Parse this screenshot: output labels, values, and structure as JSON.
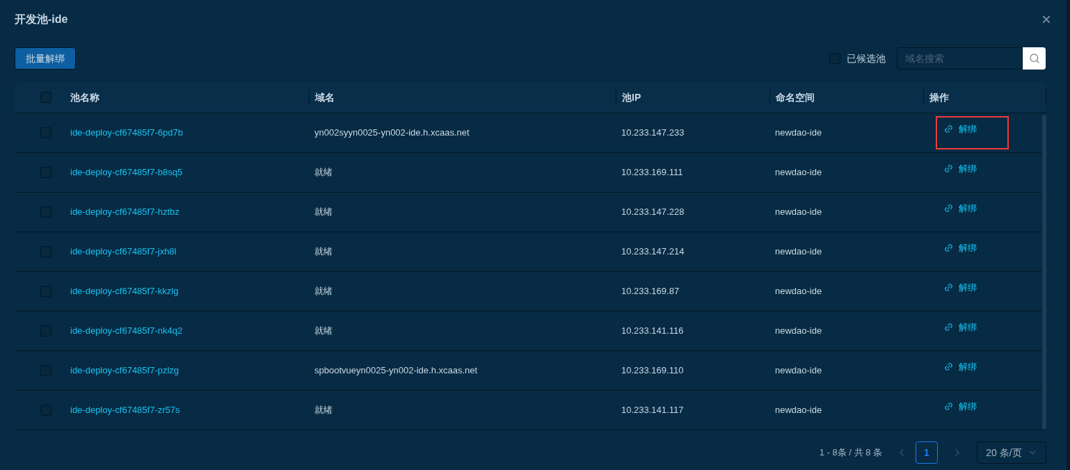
{
  "dialog": {
    "title": "开发池-ide",
    "close": "×"
  },
  "toolbar": {
    "batch_button": "批量解绑",
    "candidate_checkbox": {
      "label": "已候选池",
      "checked": false
    },
    "search": {
      "placeholder": "域名搜索"
    }
  },
  "table": {
    "header_checkbox": {
      "checked": false
    },
    "columns": [
      "池名称",
      "域名",
      "池IP",
      "命名空间",
      "操作"
    ],
    "rows": [
      {
        "checked": false,
        "name": "ide-deploy-cf67485f7-6pd7b",
        "domain": "yn002syyn0025-yn002-ide.h.xcaas.net",
        "ip": "10.233.147.233",
        "namespace": "newdao-ide",
        "action": "解绑",
        "highlighted": true
      },
      {
        "checked": false,
        "name": "ide-deploy-cf67485f7-b8sq5",
        "domain": "就绪",
        "ip": "10.233.169.111",
        "namespace": "newdao-ide",
        "action": "解绑",
        "highlighted": false
      },
      {
        "checked": false,
        "name": "ide-deploy-cf67485f7-hztbz",
        "domain": "就绪",
        "ip": "10.233.147.228",
        "namespace": "newdao-ide",
        "action": "解绑",
        "highlighted": false
      },
      {
        "checked": false,
        "name": "ide-deploy-cf67485f7-jxh8l",
        "domain": "就绪",
        "ip": "10.233.147.214",
        "namespace": "newdao-ide",
        "action": "解绑",
        "highlighted": false
      },
      {
        "checked": false,
        "name": "ide-deploy-cf67485f7-kkzlg",
        "domain": "就绪",
        "ip": "10.233.169.87",
        "namespace": "newdao-ide",
        "action": "解绑",
        "highlighted": false
      },
      {
        "checked": false,
        "name": "ide-deploy-cf67485f7-nk4q2",
        "domain": "就绪",
        "ip": "10.233.141.116",
        "namespace": "newdao-ide",
        "action": "解绑",
        "highlighted": false
      },
      {
        "checked": false,
        "name": "ide-deploy-cf67485f7-pzlzg",
        "domain": "spbootvueyn0025-yn002-ide.h.xcaas.net",
        "ip": "10.233.169.110",
        "namespace": "newdao-ide",
        "action": "解绑",
        "highlighted": false
      },
      {
        "checked": false,
        "name": "ide-deploy-cf67485f7-zr57s",
        "domain": "就绪",
        "ip": "10.233.141.117",
        "namespace": "newdao-ide",
        "action": "解绑",
        "highlighted": false
      }
    ]
  },
  "pagination": {
    "summary": "1 - 8条 / 共 8 条",
    "pages": [
      {
        "label": "1",
        "selected": true
      }
    ],
    "page_size": "20 条/页"
  }
}
